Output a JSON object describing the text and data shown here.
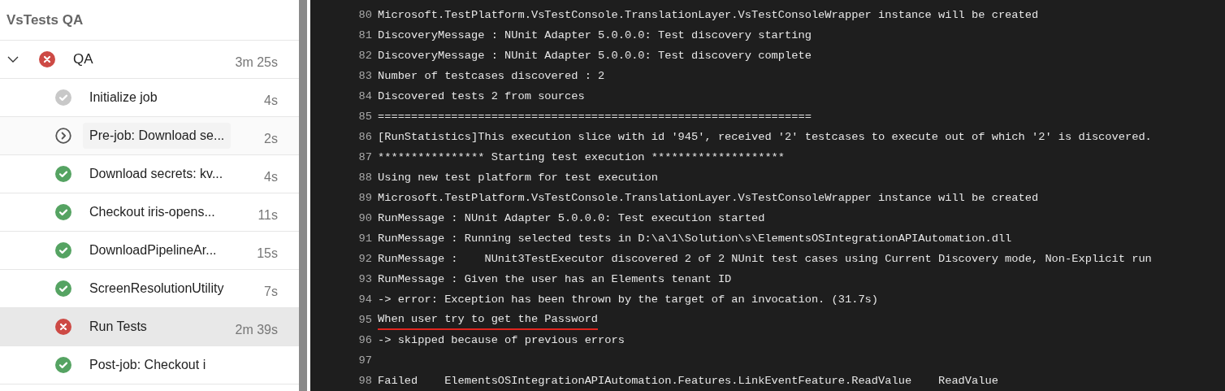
{
  "sidebar": {
    "title": "VsTests QA",
    "job": {
      "name": "QA",
      "kind": "failed",
      "duration": "3m 25s",
      "expanded": true
    },
    "steps": [
      {
        "name": "Initialize job",
        "kind": "neutral",
        "duration": "4s",
        "selected": false,
        "hovered": false
      },
      {
        "name": "Pre-job: Download se...",
        "kind": "pending",
        "duration": "2s",
        "selected": false,
        "hovered": true
      },
      {
        "name": "Download secrets: kv...",
        "kind": "succeeded",
        "duration": "4s",
        "selected": false,
        "hovered": false
      },
      {
        "name": "Checkout iris-opens...",
        "kind": "succeeded",
        "duration": "11s",
        "selected": false,
        "hovered": false
      },
      {
        "name": "DownloadPipelineAr...",
        "kind": "succeeded",
        "duration": "15s",
        "selected": false,
        "hovered": false
      },
      {
        "name": "ScreenResolutionUtility",
        "kind": "succeeded",
        "duration": "7s",
        "selected": false,
        "hovered": false
      },
      {
        "name": "Run Tests",
        "kind": "failed",
        "duration": "2m 39s",
        "selected": true,
        "hovered": false
      },
      {
        "name": "Post-job: Checkout i",
        "kind": "succeeded",
        "selected": false,
        "hovered": false
      }
    ]
  },
  "log": {
    "lines": [
      {
        "number": "80",
        "text": "Microsoft.TestPlatform.VsTestConsole.TranslationLayer.VsTestConsoleWrapper instance will be created"
      },
      {
        "number": "81",
        "text": "DiscoveryMessage : NUnit Adapter 5.0.0.0: Test discovery starting"
      },
      {
        "number": "82",
        "text": "DiscoveryMessage : NUnit Adapter 5.0.0.0: Test discovery complete"
      },
      {
        "number": "83",
        "text": "Number of testcases discovered : 2"
      },
      {
        "number": "84",
        "text": "Discovered tests 2 from sources"
      },
      {
        "number": "85",
        "text": "================================================================="
      },
      {
        "number": "86",
        "text": "[RunStatistics]This execution slice with id '945', received '2' testcases to execute out of which '2' is discovered."
      },
      {
        "number": "87",
        "text": "**************** Starting test execution ********************"
      },
      {
        "number": "88",
        "text": "Using new test platform for test execution"
      },
      {
        "number": "89",
        "text": "Microsoft.TestPlatform.VsTestConsole.TranslationLayer.VsTestConsoleWrapper instance will be created"
      },
      {
        "number": "90",
        "text": "RunMessage : NUnit Adapter 5.0.0.0: Test execution started"
      },
      {
        "number": "91",
        "text": "RunMessage : Running selected tests in D:\\a\\1\\Solution\\s\\ElementsOSIntegrationAPIAutomation.dll"
      },
      {
        "number": "92",
        "text": "RunMessage :    NUnit3TestExecutor discovered 2 of 2 NUnit test cases using Current Discovery mode, Non-Explicit run"
      },
      {
        "number": "93",
        "text": "RunMessage : Given the user has an Elements tenant ID"
      },
      {
        "number": "94",
        "text": "-> error: Exception has been thrown by the target of an invocation. (31.7s)"
      },
      {
        "number": "95",
        "text": "When user try to get the Password",
        "underlined": true
      },
      {
        "number": "96",
        "text": "-> skipped because of previous errors"
      },
      {
        "number": "97"
      },
      {
        "number": "98",
        "text": "Failed    ElementsOSIntegrationAPIAutomation.Features.LinkEventFeature.ReadValue    ReadValue"
      }
    ]
  }
}
